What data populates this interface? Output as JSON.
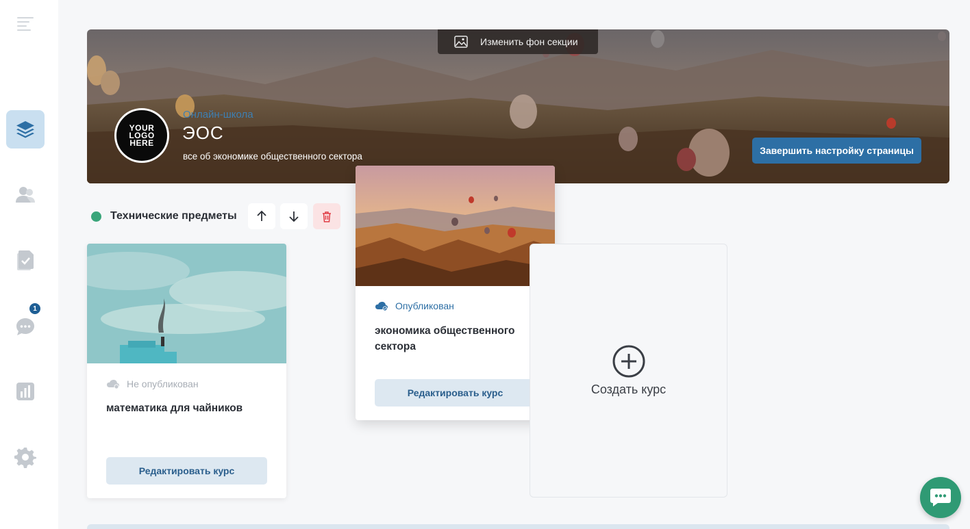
{
  "banner": {
    "change_background_label": "Изменить фон секции",
    "logo_text": [
      "YOUR",
      "LOGO",
      "HERE"
    ],
    "school_kind": "Онлайн-школа",
    "school_name": "ЭОС",
    "school_description": "все об экономике общественного сектора",
    "finish_setup_label": "Завершить настройку страницы"
  },
  "sidebar": {
    "items": [
      {
        "icon": "menu-icon"
      },
      {
        "icon": "layers-icon",
        "active": true
      },
      {
        "icon": "users-icon"
      },
      {
        "icon": "document-check-icon"
      },
      {
        "icon": "chat-icon",
        "badge": "1"
      },
      {
        "icon": "analytics-icon"
      },
      {
        "icon": "settings-icon"
      }
    ]
  },
  "section": {
    "title": "Технические предметы",
    "status_color": "#3aa57a",
    "controls": [
      "arrow-up-icon",
      "arrow-down-icon",
      "trash-icon"
    ]
  },
  "courses": [
    {
      "status": "Не опубликован",
      "status_color": "#a7adb5",
      "title": "математика для чайников",
      "edit_label": "Редактировать курс"
    },
    {
      "status": "Опубликован",
      "status_color": "#2d6fa5",
      "title": "экономика общественного сектора",
      "edit_label": "Редактировать курс"
    }
  ],
  "create_course": {
    "label": "Создать курс"
  },
  "colors": {
    "accent": "#2d6fa5",
    "sidebar_active": "#c9dff0",
    "chat_fab": "#2f9a74",
    "danger_bg": "#fbe3e4"
  }
}
